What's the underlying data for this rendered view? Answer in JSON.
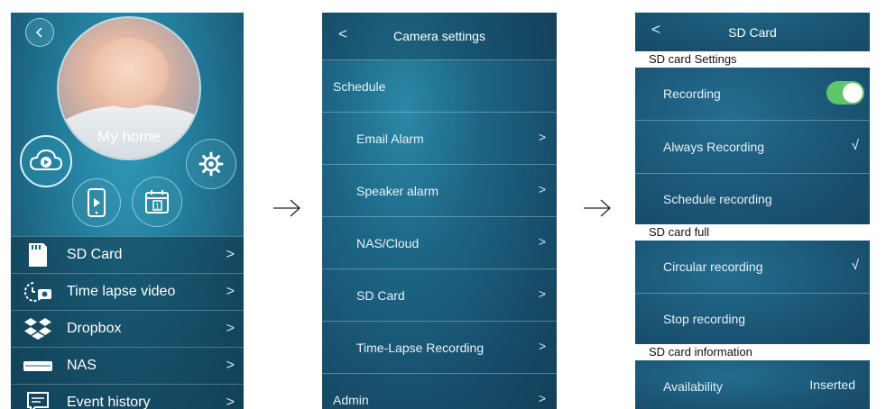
{
  "screen1": {
    "home_label": "My home",
    "menu": [
      {
        "label": "SD Card",
        "icon": "sd-card-icon"
      },
      {
        "label": "Time lapse video",
        "icon": "time-lapse-camera-icon"
      },
      {
        "label": "Dropbox",
        "icon": "dropbox-icon"
      },
      {
        "label": "NAS",
        "icon": "nas-drive-icon"
      },
      {
        "label": "Event history",
        "icon": "chat-bubble-icon"
      }
    ]
  },
  "screen2": {
    "title": "Camera settings",
    "back": "<",
    "rows": [
      {
        "label": "Schedule"
      },
      {
        "label": "Email Alarm"
      },
      {
        "label": "Speaker alarm"
      },
      {
        "label": "NAS/Cloud"
      },
      {
        "label": "SD Card"
      },
      {
        "label": "Time-Lapse Recording"
      },
      {
        "label": "Admin"
      }
    ]
  },
  "screen3": {
    "title": "SD Card",
    "back": "<",
    "sections": {
      "settings": {
        "header": "SD card Settings",
        "recording_label": "Recording",
        "recording_on": true,
        "always_label": "Always Recording",
        "schedule_label": "Schedule recording"
      },
      "full": {
        "header": "SD card full",
        "circular_label": "Circular recording",
        "stop_label": "Stop recording"
      },
      "info": {
        "header": "SD card information",
        "availability_label": "Availability",
        "availability_value": "Inserted"
      }
    }
  },
  "glyphs": {
    "chevron": ">",
    "check": "√"
  },
  "colors": {
    "toggle_on": "#5cc66a",
    "panel_dark": "#164a66",
    "panel_light": "#2a88a6"
  }
}
